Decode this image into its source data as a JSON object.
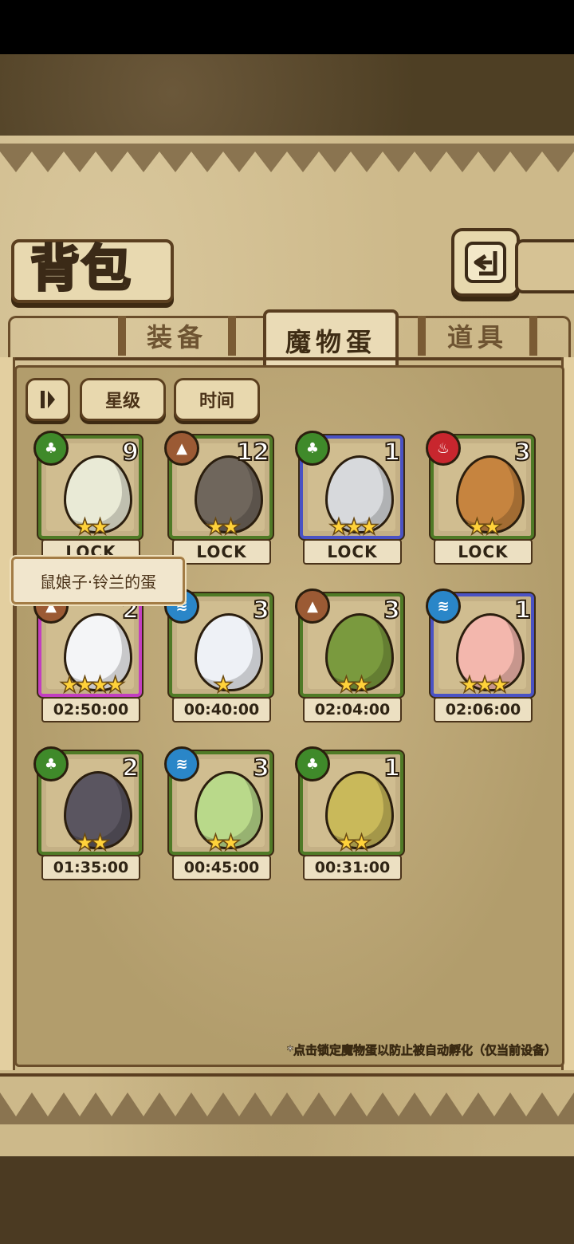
{
  "title": "背包",
  "tabs": [
    {
      "label": "装备",
      "active": false
    },
    {
      "label": "魔物蛋",
      "active": true
    },
    {
      "label": "道具",
      "active": false
    }
  ],
  "filters": {
    "sort_icon": "sort-toggle-icon",
    "star": "星级",
    "time": "时间"
  },
  "tooltip": "鼠娘子·铃兰的蛋",
  "eggs": [
    {
      "count": "9",
      "element": "grass",
      "stars": "★★",
      "footer": "LOCK",
      "rarity": "green"
    },
    {
      "count": "12",
      "element": "earth",
      "stars": "★★",
      "footer": "LOCK",
      "rarity": "green"
    },
    {
      "count": "1",
      "element": "grass",
      "stars": "★★★",
      "footer": "LOCK",
      "rarity": "blue"
    },
    {
      "count": "3",
      "element": "fire",
      "stars": "★★",
      "footer": "LOCK",
      "rarity": "green"
    },
    {
      "count": "2",
      "element": "earth",
      "stars": "★★★★",
      "footer": "02:50:00",
      "rarity": "pink"
    },
    {
      "count": "3",
      "element": "water",
      "stars": "★",
      "footer": "00:40:00",
      "rarity": "green"
    },
    {
      "count": "3",
      "element": "earth",
      "stars": "★★",
      "footer": "02:04:00",
      "rarity": "green"
    },
    {
      "count": "1",
      "element": "water",
      "stars": "★★★",
      "footer": "02:06:00",
      "rarity": "blue"
    },
    {
      "count": "2",
      "element": "grass",
      "stars": "★★",
      "footer": "01:35:00",
      "rarity": "green"
    },
    {
      "count": "3",
      "element": "water",
      "stars": "★★",
      "footer": "00:45:00",
      "rarity": "green"
    },
    {
      "count": "1",
      "element": "grass",
      "stars": "★★",
      "footer": "00:31:00",
      "rarity": "green"
    }
  ],
  "note": "*点击锁定魔物蛋以防止被自动孵化（仅当前设备）",
  "colors": {
    "grass": "#3f8a2a",
    "earth": "#9b5a34",
    "fire": "#c8262e",
    "water": "#2a86c8"
  }
}
